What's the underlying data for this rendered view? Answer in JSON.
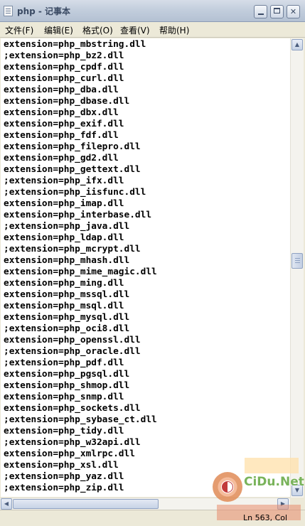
{
  "window": {
    "title": "php - 记事本",
    "controls": {
      "minimize": "",
      "maximize": "",
      "close": "✕"
    }
  },
  "menu": [
    {
      "label": "文件(F)"
    },
    {
      "label": "编辑(E)"
    },
    {
      "label": "格式(O)"
    },
    {
      "label": "查看(V)"
    },
    {
      "label": "帮助(H)"
    }
  ],
  "editor": {
    "lines": [
      "extension=php_mbstring.dll",
      ";extension=php_bz2.dll",
      "extension=php_cpdf.dll",
      "extension=php_curl.dll",
      "extension=php_dba.dll",
      "extension=php_dbase.dll",
      "extension=php_dbx.dll",
      "extension=php_exif.dll",
      "extension=php_fdf.dll",
      "extension=php_filepro.dll",
      "extension=php_gd2.dll",
      "extension=php_gettext.dll",
      ";extension=php_ifx.dll",
      ";extension=php_iisfunc.dll",
      "extension=php_imap.dll",
      "extension=php_interbase.dll",
      ";extension=php_java.dll",
      "extension=php_ldap.dll",
      ";extension=php_mcrypt.dll",
      "extension=php_mhash.dll",
      "extension=php_mime_magic.dll",
      "extension=php_ming.dll",
      "extension=php_mssql.dll",
      "extension=php_msql.dll",
      "extension=php_mysql.dll",
      ";extension=php_oci8.dll",
      "extension=php_openssl.dll",
      ";extension=php_oracle.dll",
      ";extension=php_pdf.dll",
      "extension=php_pgsql.dll",
      "extension=php_shmop.dll",
      "extension=php_snmp.dll",
      "extension=php_sockets.dll",
      ";extension=php_sybase_ct.dll",
      "extension=php_tidy.dll",
      ";extension=php_w32api.dll",
      "extension=php_xmlrpc.dll",
      "extension=php_xsl.dll",
      ";extension=php_yaz.dll",
      ";extension=php_zip.dll"
    ]
  },
  "scrollbars": {
    "vertical": {
      "up": "▲",
      "down": "▼"
    },
    "horizontal": {
      "left": "◀",
      "right": "▶"
    }
  },
  "status": {
    "position": "Ln 563, Col"
  },
  "watermark": {
    "text": "CiDu.Net"
  }
}
